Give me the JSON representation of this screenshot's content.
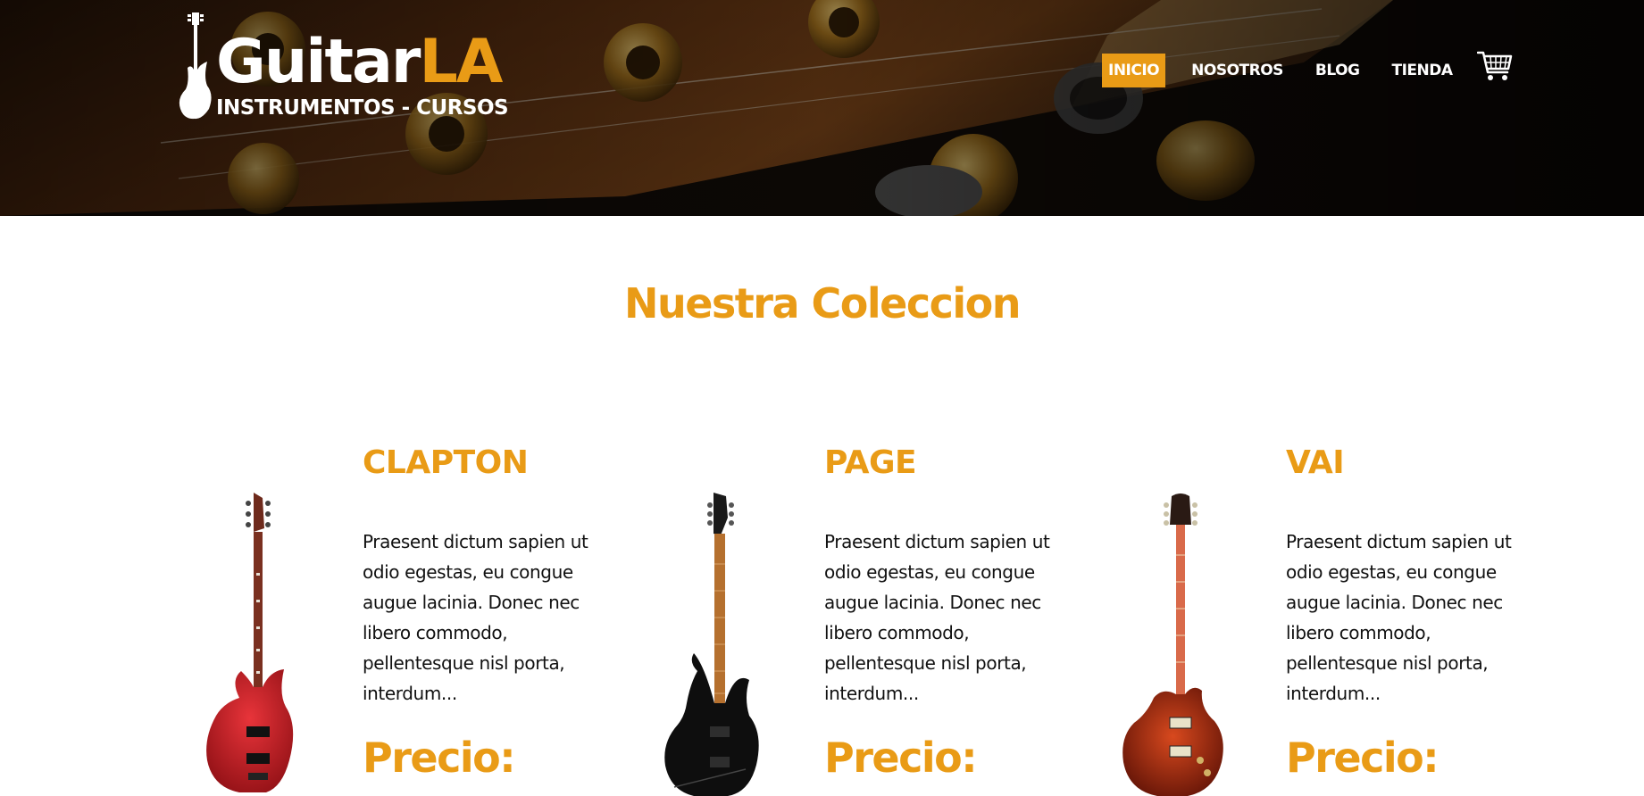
{
  "brand": {
    "name_part1": "Guitar",
    "name_part2": "LA",
    "tagline": "INSTRUMENTOS - CURSOS",
    "accent_color": "#e99b16"
  },
  "nav": {
    "items": [
      {
        "label": "INICIO",
        "active": true
      },
      {
        "label": "NOSOTROS",
        "active": false
      },
      {
        "label": "BLOG",
        "active": false
      },
      {
        "label": "TIENDA",
        "active": false
      }
    ],
    "cart_icon": "shopping-cart-icon"
  },
  "main": {
    "title": "Nuestra Coleccion",
    "products": [
      {
        "name": "CLAPTON",
        "description": "Praesent dictum sapien ut odio egestas, eu congue augue lacinia. Donec nec libero commodo, pellentesque nisl porta, interdum...",
        "price_label": "Precio:",
        "image_icon": "red-superstrat-guitar-image"
      },
      {
        "name": "PAGE",
        "description": "Praesent dictum sapien ut odio egestas, eu congue augue lacinia. Donec nec libero commodo, pellentesque nisl porta, interdum...",
        "price_label": "Precio:",
        "image_icon": "black-electric-guitar-image"
      },
      {
        "name": "VAI",
        "description": "Praesent dictum sapien ut odio egestas, eu congue augue lacinia. Donec nec libero commodo, pellentesque nisl porta, interdum...",
        "price_label": "Precio:",
        "image_icon": "cherry-les-paul-guitar-image"
      }
    ]
  }
}
